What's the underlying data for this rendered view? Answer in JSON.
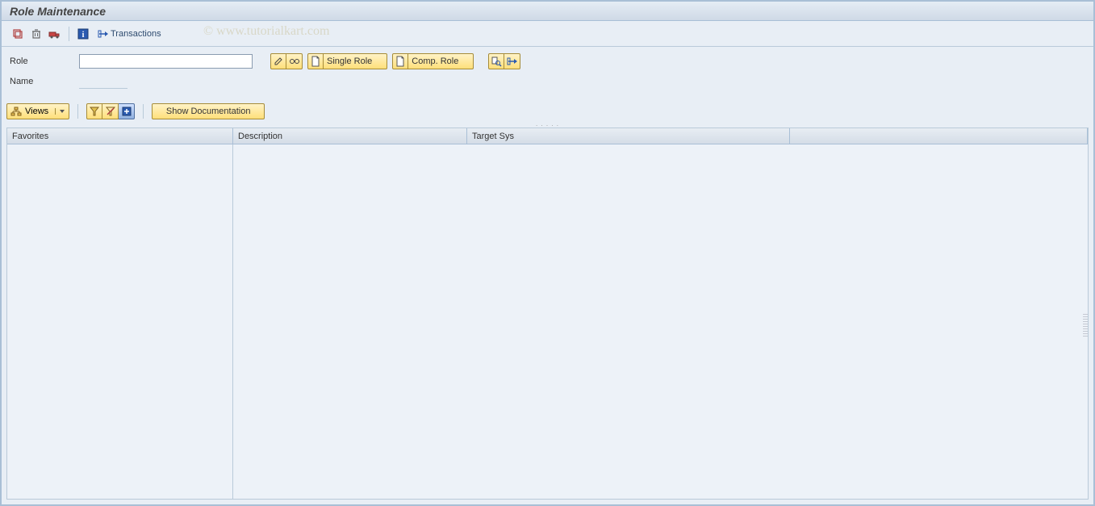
{
  "title": "Role Maintenance",
  "toolbar": {
    "transactions_label": "Transactions"
  },
  "watermark": "© www.tutorialkart.com",
  "form": {
    "role_label": "Role",
    "role_value": "",
    "name_label": "Name",
    "single_role_label": "Single Role",
    "comp_role_label": "Comp. Role"
  },
  "lower_toolbar": {
    "views_label": "Views",
    "show_doc_label": "Show Documentation"
  },
  "grid": {
    "columns": {
      "favorites": "Favorites",
      "description": "Description",
      "target_sys": "Target Sys"
    }
  }
}
